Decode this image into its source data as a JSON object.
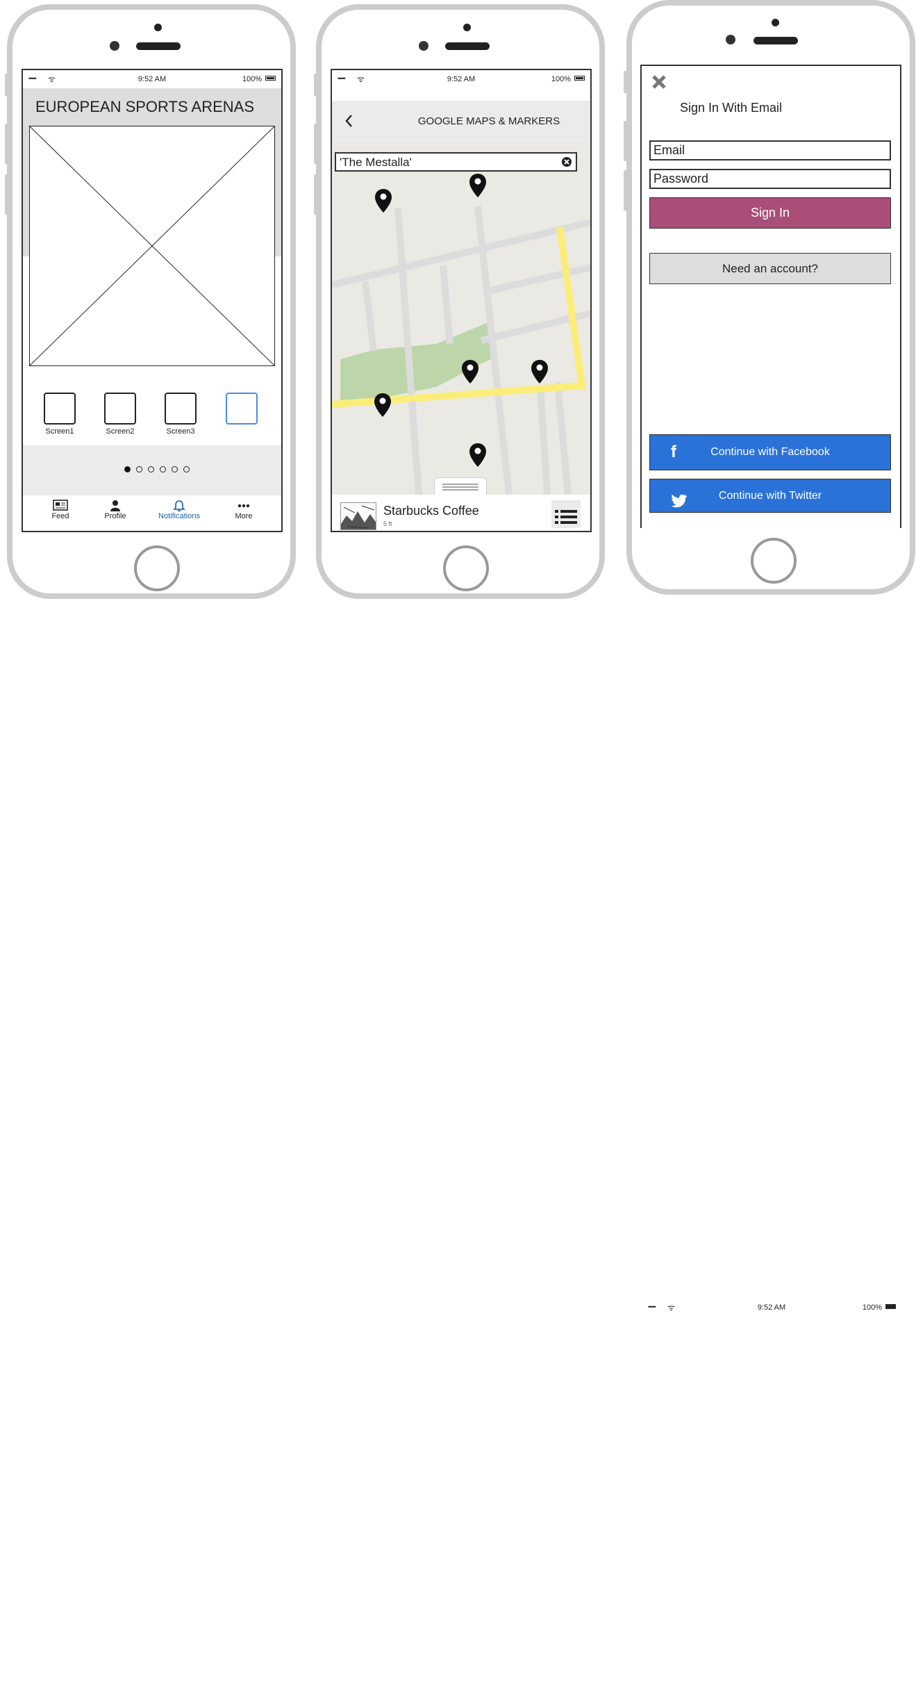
{
  "phone1": {
    "status": {
      "signal": "•••••",
      "time": "9:52 AM",
      "battery": "100%"
    },
    "title": "EUROPEAN SPORTS ARENAS",
    "thumbnails": [
      "Screen1",
      "Screen2",
      "Screen3",
      ""
    ],
    "pager": {
      "total": 6,
      "active": 0
    },
    "tabs": [
      {
        "label": "Feed",
        "icon": "newspaper-icon"
      },
      {
        "label": "Profile",
        "icon": "person-icon"
      },
      {
        "label": "Notifications",
        "icon": "bell-icon"
      },
      {
        "label": "More",
        "icon": "more-icon"
      }
    ],
    "active_tab": "Notifications",
    "colors": {
      "active": "#1a5ca8"
    }
  },
  "phone2": {
    "status": {
      "signal": "•••••",
      "time": "9:52 AM",
      "battery": "100%"
    },
    "header_title": "GOOGLE MAPS & MARKERS",
    "search_value": "'The Mestalla'",
    "card": {
      "name": "Starbucks Coffee",
      "distance": "5 ft"
    },
    "colors": {
      "map_bg": "#ebe9e4",
      "road": "#dcdcdc",
      "highway": "#fbee78",
      "park": "#bcd6aa"
    }
  },
  "phone3": {
    "title": "Sign In With Email",
    "email_placeholder": "Email",
    "password_placeholder": "Password",
    "signin_label": "Sign In",
    "need_account_label": "Need an account?",
    "facebook_label": "Continue with Facebook",
    "twitter_label": "Continue with Twitter",
    "colors": {
      "signin": "#a84e78",
      "social": "#2a72d8",
      "secondary": "#dddddd"
    }
  },
  "floating_status": {
    "signal": "•••••",
    "time": "9:52 AM",
    "battery": "100%"
  }
}
